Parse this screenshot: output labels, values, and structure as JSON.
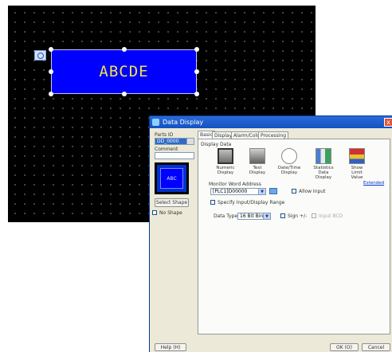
{
  "canvas": {
    "part_text": "ABCDE"
  },
  "dialog": {
    "title": "Data Display",
    "close_label": "x",
    "parts_id_label": "Parts ID",
    "parts_id_value": "DD_0000",
    "comment_label": "Comment",
    "comment_value": "",
    "preview_text": "ABC",
    "select_shape_label": "Select Shape",
    "no_shape_label": "No Shape",
    "tabs": [
      "Basic",
      "Display",
      "Alarm/Color",
      "Processing"
    ],
    "display_data_label": "Display Data",
    "display_types": [
      {
        "label": "Numeric Display",
        "icon": "numeric-display-icon"
      },
      {
        "label": "Text Display",
        "icon": "text-display-icon"
      },
      {
        "label": "Date/Time Display",
        "icon": "datetime-display-icon"
      },
      {
        "label": "Statistics Data Display",
        "icon": "statistics-display-icon"
      },
      {
        "label": "Show Limit Value",
        "icon": "limit-value-icon"
      }
    ],
    "monitor_address_label": "Monitor Word Address",
    "monitor_address_value": "[PLC1]D00000",
    "allow_input_label": "Allow Input",
    "extended_link": "Extended",
    "specify_range_label": "Specify Input/Display Range",
    "data_type_label": "Data Type",
    "data_type_value": "16 Bit Bin",
    "sign_label": "Sign +/-",
    "input_bcd_label": "Input BCD",
    "help_button": "Help (H)",
    "ok_button": "OK (O)",
    "cancel_button": "Cancel"
  }
}
